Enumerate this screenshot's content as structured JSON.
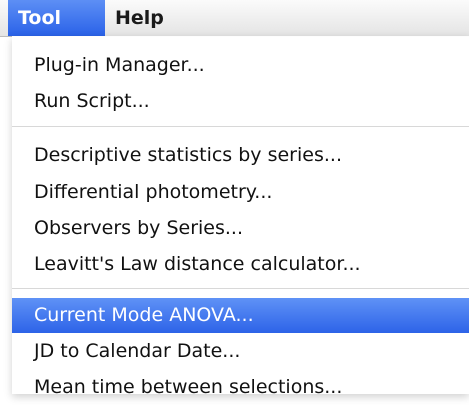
{
  "menubar": {
    "tool": "Tool",
    "help": "Help"
  },
  "menu": {
    "items": [
      "Plug-in Manager...",
      "Run Script...",
      "Descriptive statistics by series...",
      "Differential photometry...",
      "Observers by Series...",
      "Leavitt's Law distance calculator...",
      "Current Mode ANOVA...",
      "JD to Calendar Date...",
      "Mean time between selections..."
    ],
    "selected": "Current Mode ANOVA..."
  }
}
